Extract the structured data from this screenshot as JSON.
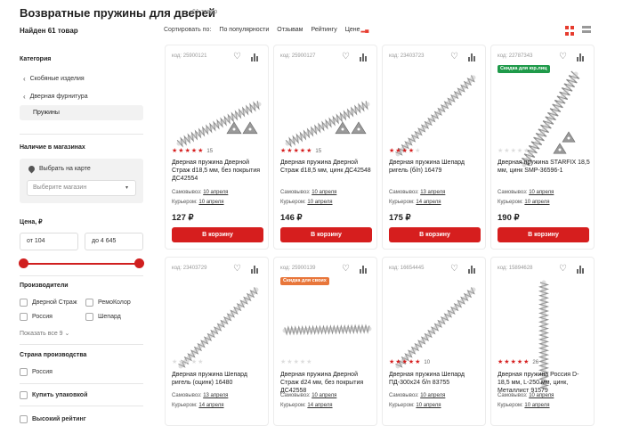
{
  "page": {
    "title": "Возвратные пружины для дверей",
    "count": "61 товар",
    "found": "Найден 61 товар"
  },
  "sort": {
    "label": "Сортировать по:",
    "options": [
      "По популярности",
      "Отзывам",
      "Рейтингу",
      "Цене"
    ]
  },
  "sidebar": {
    "category_heading": "Категория",
    "categories": [
      "Скобяные изделия",
      "Дверная фурнитура",
      "Пружины"
    ],
    "stores_heading": "Наличие в магазинах",
    "map_link": "Выбрать на карте",
    "store_placeholder": "Выберите магазин",
    "price_heading": "Цена, ₽",
    "price_from": "от 104",
    "price_to": "до 4 645",
    "makers_heading": "Производители",
    "makers": [
      "Дверной Страж",
      "РемоКолор",
      "Россия",
      "Шепард"
    ],
    "show_all": "Показать все 9",
    "country_heading": "Страна производства",
    "countries": [
      "Россия"
    ],
    "buy_pack": "Купить упаковкой",
    "high_rating": "Высокий рейтинг"
  },
  "labels": {
    "pickup": "Самовывоз:",
    "courier": "Курьером:",
    "cart": "В корзину"
  },
  "colors": {
    "accent": "#d61e1e",
    "badge_green": "#1f9a4a",
    "badge_orange": "#e8763a",
    "star": "#d61e1e",
    "star_empty": "#dddddd"
  },
  "products": [
    {
      "code": "код: 25900121",
      "badge": "",
      "rating": 5,
      "reviews": "15",
      "name": "Дверная пружина Дверной Страж d18,5 мм, без покрытия ДС42554",
      "pickup": "10 апреля",
      "courier": "10 апреля",
      "price": "127 ₽"
    },
    {
      "code": "код: 25900127",
      "badge": "",
      "rating": 5,
      "reviews": "15",
      "name": "Дверная пружина Дверной Страж d18,5 мм, цинк ДС42548",
      "pickup": "10 апреля",
      "courier": "10 апреля",
      "price": "146 ₽"
    },
    {
      "code": "код: 23403723",
      "badge": "",
      "rating": 4,
      "reviews": "",
      "name": "Дверная пружина Шепард ригель (б/п) 16479",
      "pickup": "13 апреля",
      "courier": "14 апреля",
      "price": "175 ₽"
    },
    {
      "code": "код: 22787343",
      "badge": "Скидка для юр.лиц",
      "rating": 0,
      "reviews": "",
      "name": "Дверная пружина STARFIX 18,5 мм, цинк SMP-36596-1",
      "pickup": "10 апреля",
      "courier": "10 апреля",
      "price": "190 ₽"
    },
    {
      "code": "код: 23403729",
      "badge": "",
      "rating": 0,
      "reviews": "",
      "name": "Дверная пружина Шепард ригель (оцинк) 16480",
      "pickup": "13 апреля",
      "courier": "14 апреля",
      "price": ""
    },
    {
      "code": "код: 25900139",
      "badge": "Скидка для своих",
      "rating": 0,
      "reviews": "",
      "name": "Дверная пружина Дверной Страж d24 мм, без покрытия ДС42558",
      "pickup": "10 апреля",
      "courier": "14 апреля",
      "price": ""
    },
    {
      "code": "код: 16654445",
      "badge": "",
      "rating": 5,
      "reviews": "10",
      "name": "Дверная пружина Шепард ПД-300х24 б/п 83755",
      "pickup": "10 апреля",
      "courier": "10 апреля",
      "price": ""
    },
    {
      "code": "код: 15894628",
      "badge": "",
      "rating": 5,
      "reviews": "26",
      "name": "Дверная пружина Россия D-18,5 мм, L-250 мм, цинк, Металлист 91579",
      "pickup": "10 апреля",
      "courier": "10 апреля",
      "price": ""
    }
  ]
}
